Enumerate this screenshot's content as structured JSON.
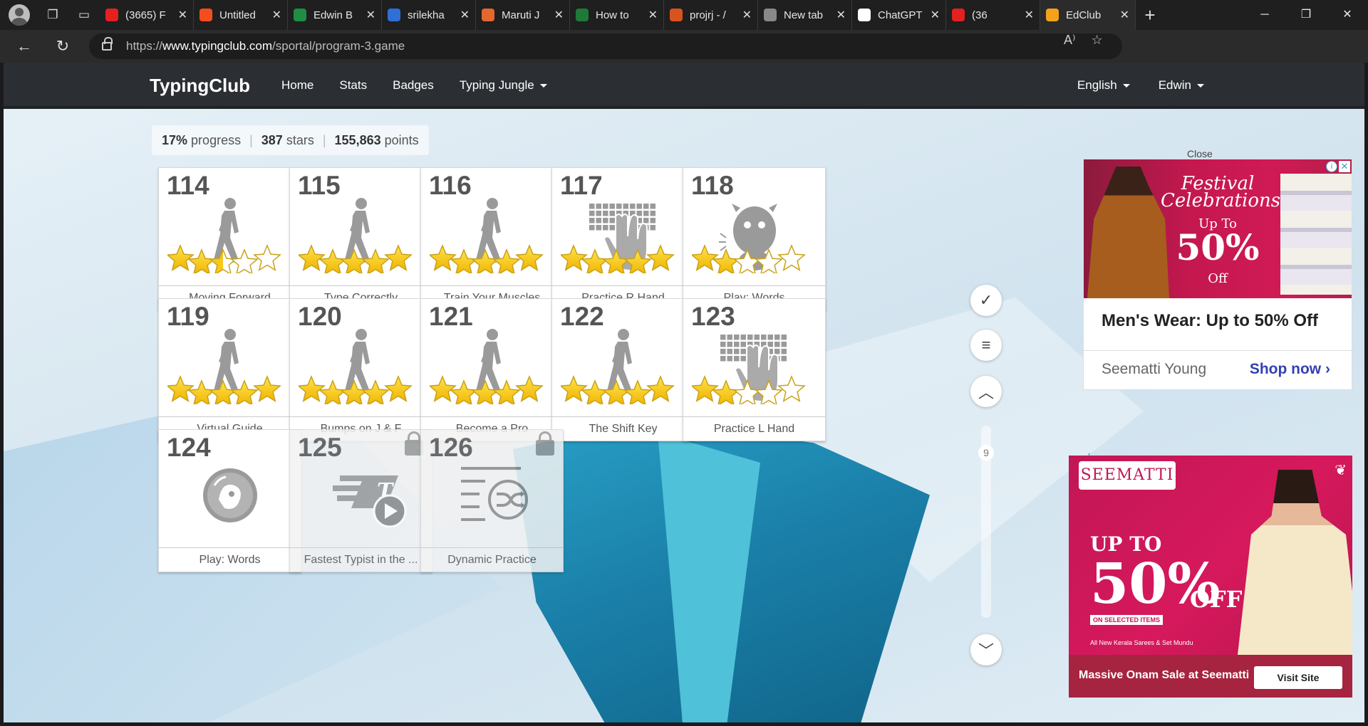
{
  "browser": {
    "tabs": [
      {
        "title": "(3665) F",
        "color": "#e52020"
      },
      {
        "title": "Untitled",
        "color": "#f24e1e"
      },
      {
        "title": "Edwin B",
        "color": "#1f8d43"
      },
      {
        "title": "srilekha",
        "color": "#2f6fd6"
      },
      {
        "title": "Maruti J",
        "color": "#e4672e"
      },
      {
        "title": "How to",
        "color": "#1f7a3a"
      },
      {
        "title": "projrj - /",
        "color": "#d9531e"
      },
      {
        "title": "New tab",
        "color": "#888888"
      },
      {
        "title": "ChatGPT",
        "color": "#ffffff"
      },
      {
        "title": "(36",
        "color": "#e52020"
      },
      {
        "title": "EdClub",
        "color": "#f4a21c"
      }
    ],
    "url_prefix": "https://",
    "url_host": "www.typingclub.com",
    "url_path": "/sportal/program-3.game"
  },
  "site": {
    "brand": "TypingClub",
    "nav": [
      "Home",
      "Stats",
      "Badges",
      "Typing Jungle"
    ],
    "language": "English",
    "user": "Edwin"
  },
  "progress": {
    "percent": "17%",
    "percent_label": "progress",
    "stars": "387",
    "stars_label": "stars",
    "points": "155,863",
    "points_label": "points"
  },
  "lessons": [
    {
      "num": "114",
      "label": "Moving Forward",
      "icon": "walker-icon",
      "stars": 2.5,
      "locked": false
    },
    {
      "num": "115",
      "label": "Type Correctly",
      "icon": "walker-icon",
      "stars": 5,
      "locked": false
    },
    {
      "num": "116",
      "label": "Train Your Muscles",
      "icon": "walker-icon",
      "stars": 5,
      "locked": false
    },
    {
      "num": "117",
      "label": "Practice R Hand",
      "icon": "hand-keyboard-icon",
      "stars": 5,
      "locked": false
    },
    {
      "num": "118",
      "label": "Play: Words",
      "icon": "monster-icon",
      "stars": 2,
      "locked": false
    },
    {
      "num": "119",
      "label": "Virtual Guide",
      "icon": "walker-icon",
      "stars": 5,
      "locked": false
    },
    {
      "num": "120",
      "label": "Bumps on J & F",
      "icon": "walker-icon",
      "stars": 5,
      "locked": false
    },
    {
      "num": "121",
      "label": "Become a Pro",
      "icon": "walker-icon",
      "stars": 5,
      "locked": false
    },
    {
      "num": "122",
      "label": "The Shift Key",
      "icon": "walker-icon",
      "stars": 5,
      "locked": false
    },
    {
      "num": "123",
      "label": "Practice L Hand",
      "icon": "hand-keyboard-icon",
      "stars": 2,
      "locked": false
    },
    {
      "num": "124",
      "label": "Play: Words",
      "icon": "bubble-game-icon",
      "stars": 0,
      "locked": false
    },
    {
      "num": "125",
      "label": "Fastest Typist in the ...",
      "icon": "speed-video-icon",
      "stars": 0,
      "locked": true
    },
    {
      "num": "126",
      "label": "Dynamic Practice",
      "icon": "shuffle-list-icon",
      "stars": 0,
      "locked": true
    }
  ],
  "side": {
    "page_number": "9"
  },
  "ad1": {
    "close": "Close",
    "festival_line1": "Festival",
    "festival_line2": "Celebrations",
    "upto": "Up To",
    "percent": "50%",
    "off": "Off",
    "headline": "Men's Wear: Up to 50% Off",
    "subline": "Seematti Young",
    "cta": "Shop now"
  },
  "ad2": {
    "logo": "SEEMATTI",
    "upto": "UP TO",
    "percent": "50%",
    "off": "OFF",
    "tag": "ON SELECTED ITEMS",
    "small": "All New Kerala Sarees & Set Mundu",
    "bar_text": "Massive Onam Sale at Seematti",
    "visit": "Visit Site"
  }
}
